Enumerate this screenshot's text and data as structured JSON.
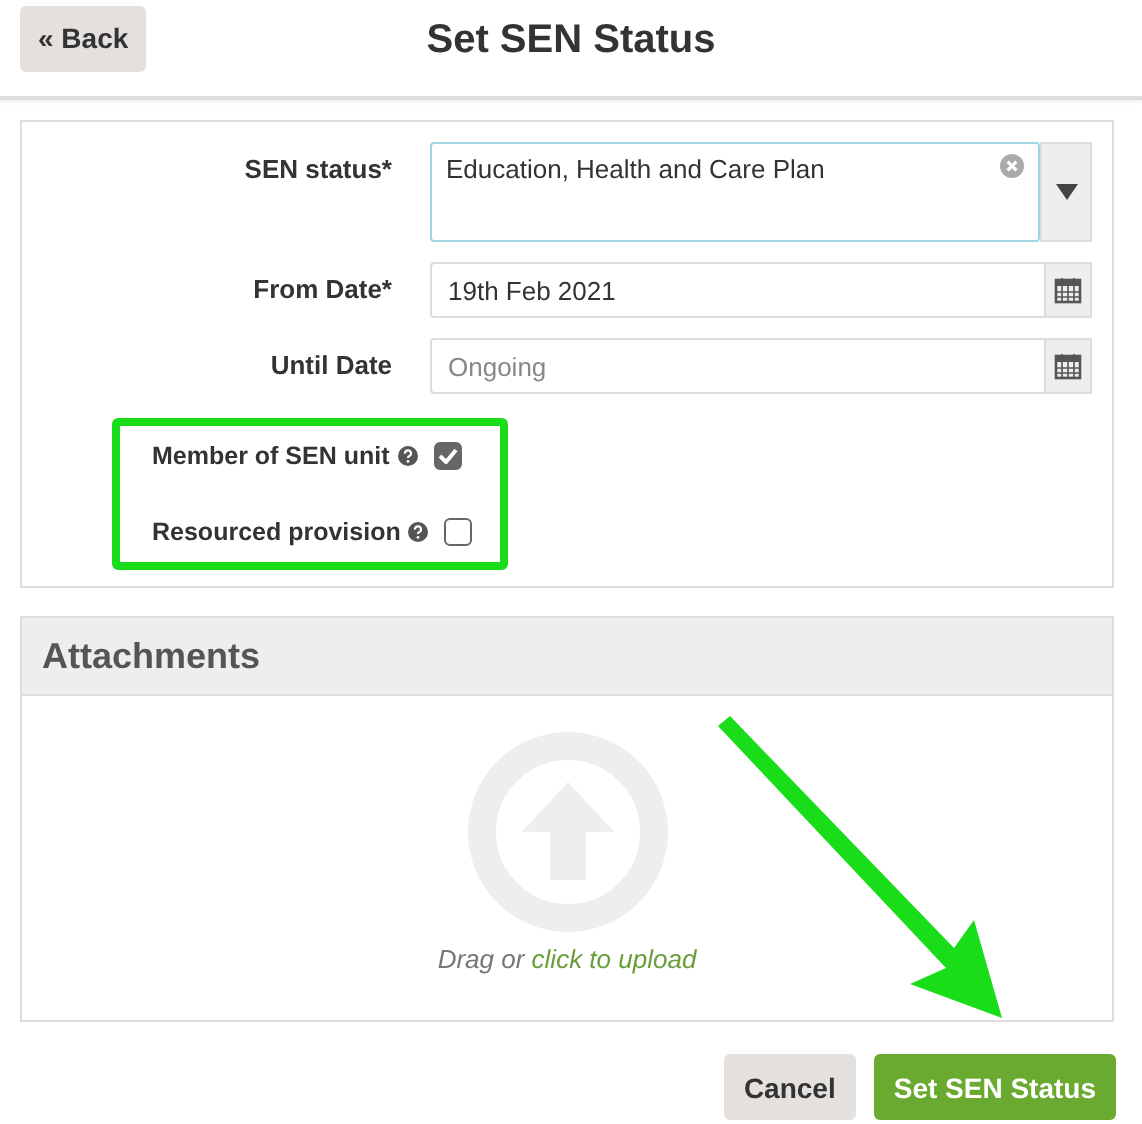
{
  "header": {
    "back_button": "« Back",
    "title": "Set SEN Status"
  },
  "form": {
    "fields": [
      {
        "kind": "select",
        "label": "SEN status*",
        "value": "Education, Health and Care Plan"
      },
      {
        "kind": "date",
        "label": "From Date*",
        "value": "19th Feb 2021"
      },
      {
        "kind": "date",
        "label": "Until Date",
        "placeholder": "Ongoing"
      }
    ],
    "checkboxes": [
      {
        "label": "Member of SEN unit",
        "checked": true
      },
      {
        "label": "Resourced provision",
        "checked": false
      }
    ]
  },
  "attachments": {
    "title": "Attachments",
    "prompt": "Drag or",
    "link": "click to upload"
  },
  "buttons": [
    {
      "kind": "secondary",
      "label": "Cancel"
    },
    {
      "kind": "primary",
      "label": "Set SEN Status"
    }
  ]
}
